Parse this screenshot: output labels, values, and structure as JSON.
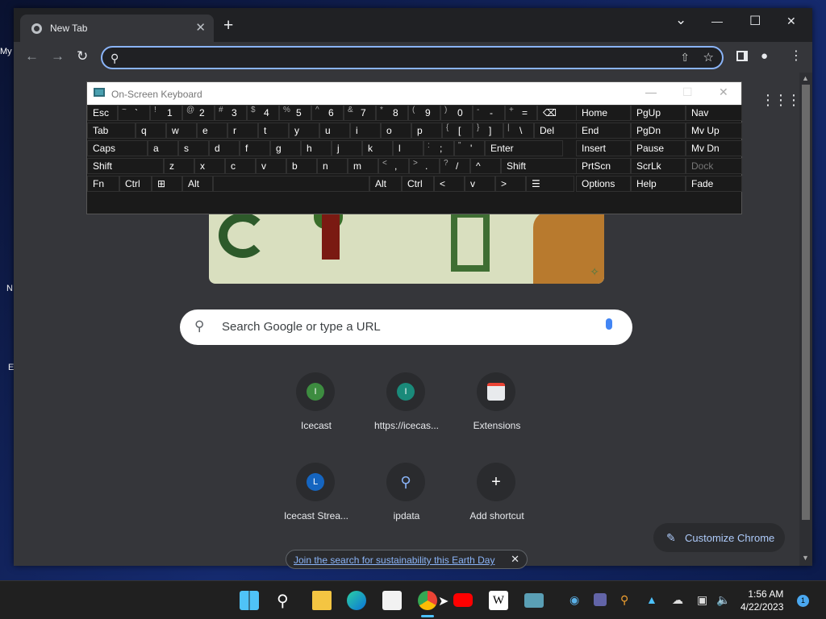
{
  "desktop": {
    "icon_labels": [
      "My",
      "N",
      "E"
    ]
  },
  "browser": {
    "tab": {
      "title": "New Tab",
      "close": "✕"
    },
    "new_tab": "+",
    "window_controls": {
      "dropdown": "⌄",
      "minimize": "—",
      "maximize": "☐",
      "close": "✕"
    },
    "toolbar": {
      "back": "←",
      "forward": "→",
      "reload": "↻",
      "search_icon": "search-icon",
      "share_icon": "share-icon",
      "bookmark_icon": "star-icon",
      "side_panel_icon": "side-panel-icon",
      "profile_icon": "profile-icon",
      "menu_icon": "kebab-menu-icon"
    },
    "omnibox_value": ""
  },
  "newtab": {
    "apps_icon": "grid-icon",
    "search_placeholder": "Search Google or type a URL",
    "shortcuts": [
      {
        "label": "Icecast",
        "letter": "I",
        "color": "#3d8c40"
      },
      {
        "label": "https://icecas...",
        "letter": "I",
        "color": "#1a8a7a"
      },
      {
        "label": "Extensions",
        "letter": "",
        "color": ""
      },
      {
        "label": "Icecast Strea...",
        "letter": "L",
        "color": "#1565c0"
      },
      {
        "label": "ipdata",
        "letter": "",
        "color": ""
      },
      {
        "label": "Add shortcut",
        "letter": "+",
        "color": ""
      }
    ],
    "customize_label": "Customize Chrome",
    "earth_day_link": "Join the search for sustainability this Earth Day",
    "earth_day_close": "✕"
  },
  "osk": {
    "title": "On-Screen Keyboard",
    "controls": {
      "minimize": "—",
      "maximize": "☐",
      "close": "✕"
    },
    "rows": [
      [
        {
          "l": "Esc"
        },
        {
          "l": "`",
          "s": "~"
        },
        {
          "l": "1",
          "s": "!"
        },
        {
          "l": "2",
          "s": "@"
        },
        {
          "l": "3",
          "s": "#"
        },
        {
          "l": "4",
          "s": "$"
        },
        {
          "l": "5",
          "s": "%"
        },
        {
          "l": "6",
          "s": "^"
        },
        {
          "l": "7",
          "s": "&"
        },
        {
          "l": "8",
          "s": "*"
        },
        {
          "l": "9",
          "s": "("
        },
        {
          "l": "0",
          "s": ")"
        },
        {
          "l": "-",
          "s": "-"
        },
        {
          "l": "=",
          "s": "+"
        },
        {
          "l": "⌫"
        }
      ],
      [
        {
          "l": "Tab"
        },
        {
          "l": "q"
        },
        {
          "l": "w"
        },
        {
          "l": "e"
        },
        {
          "l": "r"
        },
        {
          "l": "t"
        },
        {
          "l": "y"
        },
        {
          "l": "u"
        },
        {
          "l": "i"
        },
        {
          "l": "o"
        },
        {
          "l": "p"
        },
        {
          "l": "[",
          "s": "{"
        },
        {
          "l": "]",
          "s": "}"
        },
        {
          "l": "\\",
          "s": "|"
        },
        {
          "l": "Del"
        }
      ],
      [
        {
          "l": "Caps"
        },
        {
          "l": "a"
        },
        {
          "l": "s"
        },
        {
          "l": "d"
        },
        {
          "l": "f"
        },
        {
          "l": "g"
        },
        {
          "l": "h"
        },
        {
          "l": "j"
        },
        {
          "l": "k"
        },
        {
          "l": "l"
        },
        {
          "l": ";",
          "s": ":"
        },
        {
          "l": "'",
          "s": "\""
        },
        {
          "l": "Enter"
        }
      ],
      [
        {
          "l": "Shift"
        },
        {
          "l": "z"
        },
        {
          "l": "x"
        },
        {
          "l": "c"
        },
        {
          "l": "v"
        },
        {
          "l": "b"
        },
        {
          "l": "n"
        },
        {
          "l": "m"
        },
        {
          "l": ",",
          "s": "<"
        },
        {
          "l": ".",
          "s": ">"
        },
        {
          "l": "/",
          "s": "?"
        },
        {
          "l": "^"
        },
        {
          "l": "Shift"
        }
      ],
      [
        {
          "l": "Fn"
        },
        {
          "l": "Ctrl"
        },
        {
          "l": "⊞"
        },
        {
          "l": "Alt"
        },
        {
          "l": ""
        },
        {
          "l": "Alt"
        },
        {
          "l": "Ctrl"
        },
        {
          "l": "<"
        },
        {
          "l": "v"
        },
        {
          "l": ">"
        },
        {
          "l": "☰"
        }
      ]
    ],
    "nav_rows": [
      [
        "Home",
        "PgUp",
        "Nav"
      ],
      [
        "End",
        "PgDn",
        "Mv Up"
      ],
      [
        "Insert",
        "Pause",
        "Mv Dn"
      ],
      [
        "PrtScn",
        "ScrLk",
        "Dock"
      ],
      [
        "Options",
        "Help",
        "Fade"
      ]
    ]
  },
  "taskbar": {
    "apps": [
      "start-icon",
      "search-icon",
      "file-explorer-icon",
      "edge-icon",
      "store-icon",
      "chrome-icon",
      "youtube-icon",
      "wikipedia-icon",
      "keyboard-app-icon"
    ],
    "wiki_letter": "W",
    "time": "1:56 AM",
    "date": "4/22/2023",
    "notifications": "1"
  }
}
